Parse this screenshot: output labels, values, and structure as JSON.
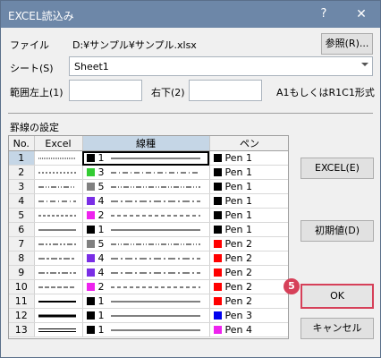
{
  "window": {
    "title": "EXCEL読込み",
    "help": "?",
    "close": "✕"
  },
  "file": {
    "label": "ファイル",
    "path": "D:¥サンプル¥サンプル.xlsx",
    "browse_button": "参照(R)..."
  },
  "sheet": {
    "label": "シート(S)",
    "value": "Sheet1"
  },
  "range": {
    "topleft_label": "範囲左上(1)",
    "topleft_value": "",
    "bottomright_label": "右下(2)",
    "bottomright_value": "",
    "hint": "A1もしくはR1C1形式"
  },
  "ruled": {
    "section_label": "罫線の設定",
    "columns": {
      "no": "No.",
      "excel": "Excel",
      "line": "線種",
      "pen": "ペン"
    },
    "rows": [
      {
        "no": "1",
        "excel": "dotted-fine",
        "color": "#000000",
        "ltnum": "1",
        "ltstyle": "solid-thin",
        "pen_color": "#000000",
        "pen": "Pen 1"
      },
      {
        "no": "2",
        "excel": "dotted",
        "color": "#33cc33",
        "ltnum": "3",
        "ltstyle": "dashdot",
        "pen_color": "#000000",
        "pen": "Pen 1"
      },
      {
        "no": "3",
        "excel": "dashdotdot",
        "color": "#808080",
        "ltnum": "5",
        "ltstyle": "dashdotdot",
        "pen_color": "#000000",
        "pen": "Pen 1"
      },
      {
        "no": "4",
        "excel": "dashdot",
        "color": "#7a2ee6",
        "ltnum": "4",
        "ltstyle": "dashdot2",
        "pen_color": "#000000",
        "pen": "Pen 1"
      },
      {
        "no": "5",
        "excel": "dashed-fine",
        "color": "#ee22ee",
        "ltnum": "2",
        "ltstyle": "dashed",
        "pen_color": "#000000",
        "pen": "Pen 1"
      },
      {
        "no": "6",
        "excel": "solid-thin",
        "color": "#000000",
        "ltnum": "1",
        "ltstyle": "solid-thin",
        "pen_color": "#000000",
        "pen": "Pen 1"
      },
      {
        "no": "7",
        "excel": "dashdotdot-md",
        "color": "#808080",
        "ltnum": "5",
        "ltstyle": "dashdotdot",
        "pen_color": "#ff0000",
        "pen": "Pen 2"
      },
      {
        "no": "8",
        "excel": "slant-dashdot",
        "color": "#7a2ee6",
        "ltnum": "4",
        "ltstyle": "dashdot2",
        "pen_color": "#ff0000",
        "pen": "Pen 2"
      },
      {
        "no": "9",
        "excel": "dashdot-md",
        "color": "#7a2ee6",
        "ltnum": "4",
        "ltstyle": "dashdot2",
        "pen_color": "#ff0000",
        "pen": "Pen 2"
      },
      {
        "no": "10",
        "excel": "dashed-md",
        "color": "#ee22ee",
        "ltnum": "2",
        "ltstyle": "dashed",
        "pen_color": "#ff0000",
        "pen": "Pen 2"
      },
      {
        "no": "11",
        "excel": "solid-medium",
        "color": "#000000",
        "ltnum": "1",
        "ltstyle": "solid-thin",
        "pen_color": "#ff0000",
        "pen": "Pen 2"
      },
      {
        "no": "12",
        "excel": "solid-thick",
        "color": "#000000",
        "ltnum": "1",
        "ltstyle": "solid-thin",
        "pen_color": "#0000ee",
        "pen": "Pen 3"
      },
      {
        "no": "13",
        "excel": "double",
        "color": "#000000",
        "ltnum": "1",
        "ltstyle": "solid-thin",
        "pen_color": "#ee22ee",
        "pen": "Pen 4"
      }
    ]
  },
  "buttons": {
    "excel": "EXCEL(E)",
    "init": "初期値(D)",
    "ok": "OK",
    "cancel": "キャンセル"
  },
  "step_badge": "5"
}
